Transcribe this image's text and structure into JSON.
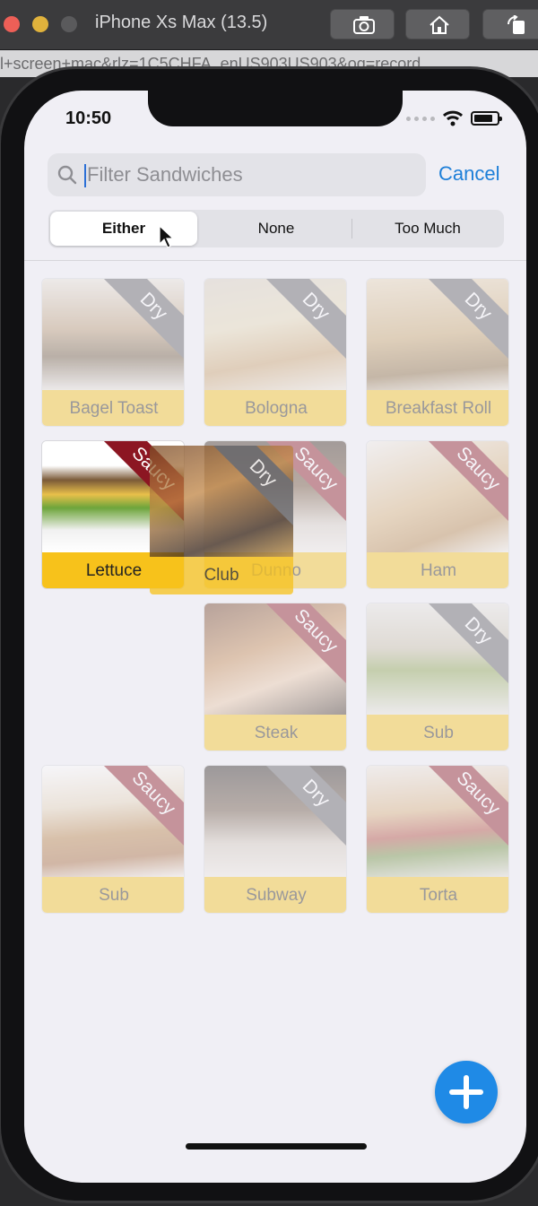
{
  "simulator": {
    "title": "iPhone Xs Max (13.5)",
    "url_fragment": "l+screen+mac&rlz=1C5CHFA_enUS903US903&oq=record"
  },
  "status_bar": {
    "time": "10:50"
  },
  "search": {
    "placeholder": "Filter Sandwiches",
    "value": "",
    "cancel_label": "Cancel"
  },
  "segments": [
    {
      "label": "Either",
      "selected": true
    },
    {
      "label": "None",
      "selected": false
    },
    {
      "label": "Too Much",
      "selected": false
    }
  ],
  "dragging_card": {
    "name": "Club",
    "tag": "Dry"
  },
  "sandwiches": [
    {
      "name": "Bagel Toast",
      "tag": "Dry",
      "dimmed": true
    },
    {
      "name": "Bologna",
      "tag": "Dry",
      "dimmed": true
    },
    {
      "name": "Breakfast Roll",
      "tag": "Dry",
      "dimmed": true
    },
    {
      "name": "Lettuce",
      "tag": "Saucy",
      "dimmed": false
    },
    {
      "name": "Dunno",
      "tag": "Saucy",
      "dimmed": true
    },
    {
      "name": "Ham",
      "tag": "Saucy",
      "dimmed": true
    },
    {
      "name": "Steak",
      "tag": "Saucy",
      "dimmed": true
    },
    {
      "name": "Sub",
      "tag": "Dry",
      "dimmed": true
    },
    {
      "name": "Sub",
      "tag": "Saucy",
      "dimmed": true
    },
    {
      "name": "Subway",
      "tag": "Dry",
      "dimmed": true
    },
    {
      "name": "Torta",
      "tag": "Saucy",
      "dimmed": true
    }
  ],
  "colors": {
    "accent": "#1e7fd8",
    "caption": "#f7c21b",
    "dry": "#5e5e62",
    "saucy": "#8c1622",
    "fab": "#1f8ae6"
  }
}
